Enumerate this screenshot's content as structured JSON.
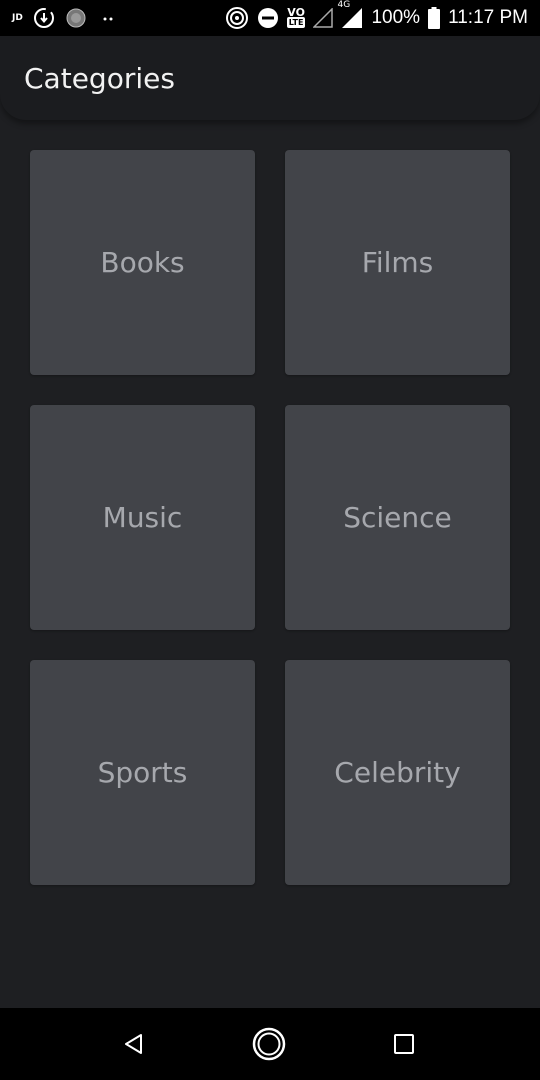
{
  "status_bar": {
    "carrier_tag": "JD",
    "network_gen": "4G",
    "volte_top": "VO",
    "volte_bottom": "LTE",
    "battery": "100%",
    "time": "11:17 PM"
  },
  "app_bar": {
    "title": "Categories"
  },
  "categories": [
    {
      "label": "Books"
    },
    {
      "label": "Films"
    },
    {
      "label": "Music"
    },
    {
      "label": "Science"
    },
    {
      "label": "Sports"
    },
    {
      "label": "Celebrity"
    }
  ],
  "nav_bar": {
    "icons": [
      "back-icon",
      "home-icon",
      "recents-icon"
    ]
  },
  "colors": {
    "background": "#1e1f22",
    "app_bar": "#1b1c1f",
    "tile": "#424449",
    "tile_text": "#a6a8ad",
    "title_text": "#f2f2f2",
    "system_bars": "#000000"
  }
}
